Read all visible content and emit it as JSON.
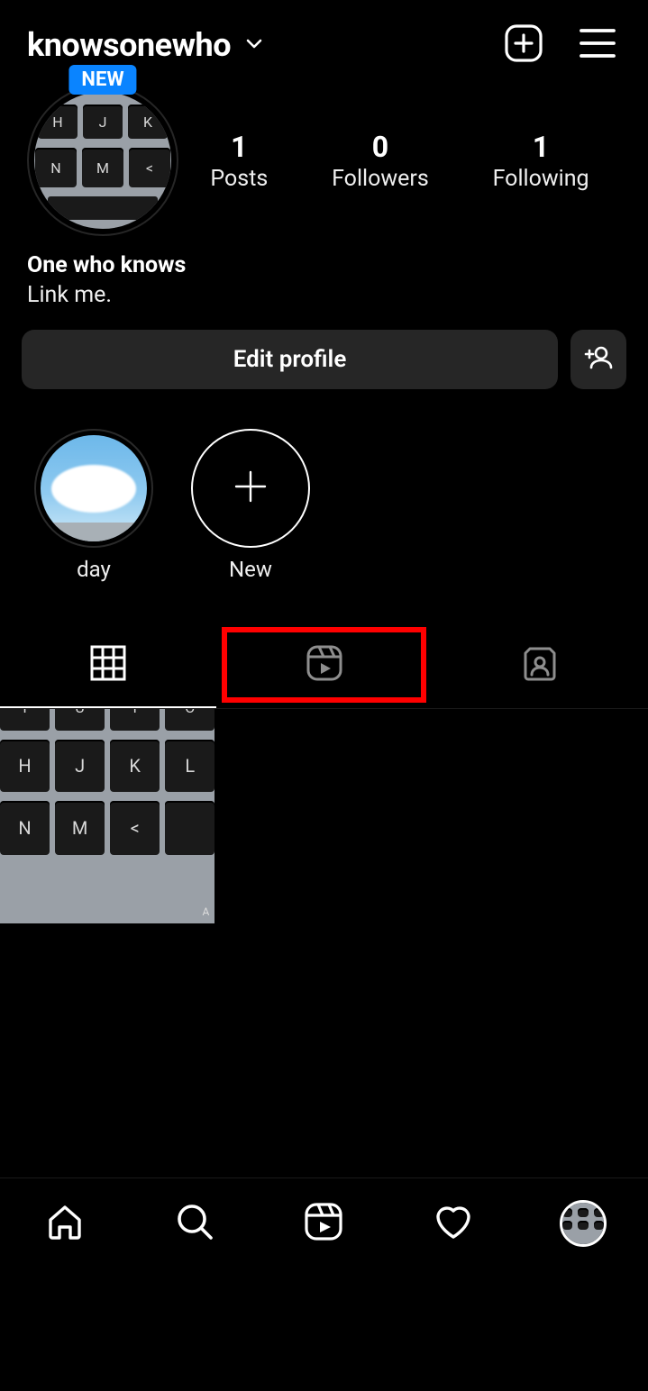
{
  "header": {
    "username": "knowsonewho"
  },
  "profile": {
    "badge": "NEW",
    "stats": {
      "posts": {
        "count": "1",
        "label": "Posts"
      },
      "followers": {
        "count": "0",
        "label": "Followers"
      },
      "following": {
        "count": "1",
        "label": "Following"
      }
    },
    "display_name": "One who knows",
    "bio": "Link me.",
    "edit_label": "Edit profile"
  },
  "highlights": [
    {
      "label": "day"
    },
    {
      "label": "New"
    }
  ],
  "tabs": {
    "active": "grid",
    "highlighted": "reels"
  }
}
